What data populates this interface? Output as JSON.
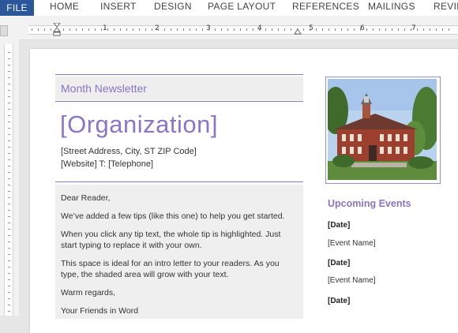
{
  "ribbon": {
    "file": "FILE",
    "tabs": [
      "HOME",
      "INSERT",
      "DESIGN",
      "PAGE LAYOUT",
      "REFERENCES",
      "MAILINGS",
      "REVIEW"
    ]
  },
  "ruler": {
    "numbers": [
      "1",
      "2",
      "3",
      "4",
      "5",
      "6",
      "7"
    ]
  },
  "newsletter": {
    "month": "Month Newsletter",
    "organization": "[Organization]",
    "address": "[Street Address, City, ST  ZIP Code]",
    "contact": "[Website] T: [Telephone]"
  },
  "letter": {
    "greeting": "Dear Reader,",
    "p1": "We’ve added a few tips (like this one) to help you get started.",
    "p2": "When you click any tip text, the whole tip is highlighted. Just start typing to replace it with your own.",
    "p3": "This space is ideal for an intro letter to your readers. As you type, the shaded area will grow with your text.",
    "closing": "Warm regards,",
    "signature": "Your Friends in Word"
  },
  "events": {
    "heading": "Upcoming Events",
    "items": [
      {
        "date": "[Date]",
        "name": "[Event Name]"
      },
      {
        "date": "[Date]",
        "name": "[Event Name]"
      },
      {
        "date": "[Date]"
      }
    ]
  },
  "colors": {
    "accent": "#8a76c9",
    "file_tab": "#2b579a",
    "shade": "#efefef"
  }
}
